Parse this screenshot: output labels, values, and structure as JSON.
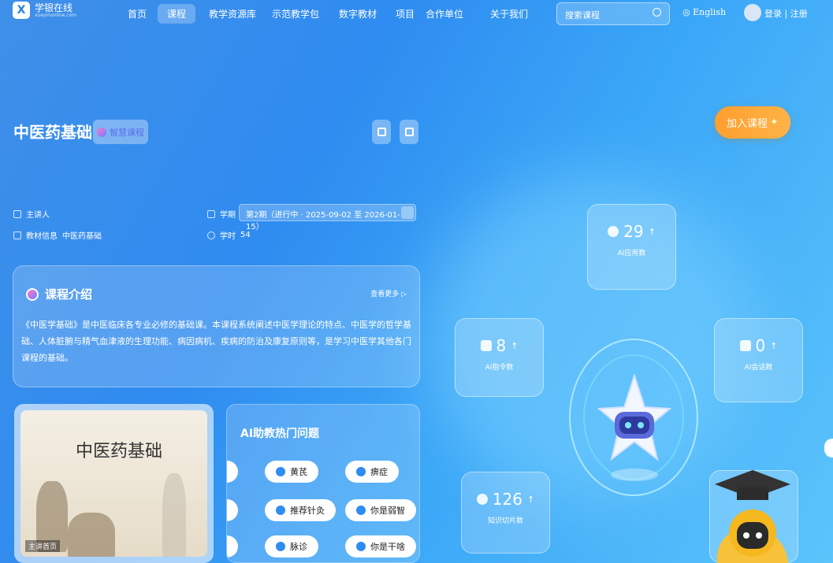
{
  "nav": {
    "logo_text": "学银在线",
    "logo_sub": "xueyinonline.com",
    "items": [
      "首页",
      "课程",
      "教学资源库",
      "示范教学包",
      "数字教材",
      "项目",
      "合作单位",
      "关于我们"
    ],
    "search_placeholder": "搜索课程",
    "language": "English",
    "login": "登录 | 注册"
  },
  "course": {
    "title": "中医药基础",
    "badge": "智慧课程",
    "join_label": "加入课程",
    "lecturer_label": "主讲人",
    "textbook_label": "教材信息",
    "textbook_value": "中医药基础",
    "term_label": "学期",
    "term_value": "第2期（进行中 · 2025-09-02 至 2026-01-15）",
    "hours_label": "学时",
    "hours_value": "54"
  },
  "intro": {
    "title": "课程介绍",
    "more": "查看更多 ▷",
    "text": "《中医学基础》是中医临床各专业必修的基础课。本课程系统阐述中医学理论的特点、中医学的哲学基础、人体脏腑与精气血津液的生理功能、病因病机、疾病的防治及康复原则等，是学习中医学其他各门课程的基础。"
  },
  "poster": {
    "title": "中医药基础",
    "caption": "主讲首页"
  },
  "ai_hot": {
    "title": "AI助教热门问题",
    "chips": [
      "黄芪",
      "痹症",
      "推荐针灸",
      "你是弱智",
      "脉诊",
      "你是干啥"
    ]
  },
  "stats": {
    "apps": {
      "value": "29",
      "arrow": "↑",
      "label": "AI应用数"
    },
    "commands": {
      "value": "8",
      "arrow": "↑",
      "label": "AI指令数"
    },
    "sessions": {
      "value": "0",
      "arrow": "↑",
      "label": "AI会话数"
    },
    "slices": {
      "value": "126",
      "arrow": "↑",
      "label": "知识切片数"
    }
  }
}
